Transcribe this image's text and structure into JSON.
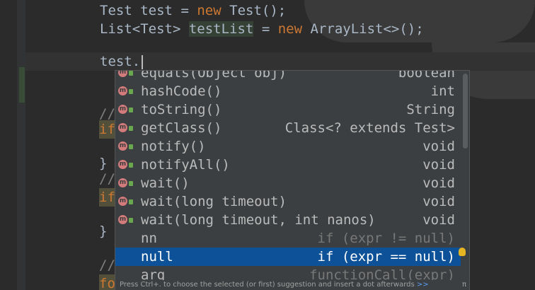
{
  "editor": {
    "line1": {
      "type": "Test",
      "var": "test",
      "op": "=",
      "kw": "new",
      "ctor": "Test();"
    },
    "line2": {
      "type": "List<Test>",
      "var": "testList",
      "op": "=",
      "kw": "new",
      "ctor": "ArrayList<>();"
    },
    "line3": "test.",
    "fragments": {
      "comment1": "//",
      "if1": "if",
      "brace1": "}",
      "comment2": "//",
      "if2": "if",
      "brace2": "}",
      "comment3": "//",
      "for1": "fo"
    }
  },
  "completion": {
    "items": [
      {
        "name": "equals(Object obj)",
        "type": "boolean",
        "kind": "method"
      },
      {
        "name": "hashCode()",
        "type": "int",
        "kind": "method"
      },
      {
        "name": "toString()",
        "type": "String",
        "kind": "method"
      },
      {
        "name": "getClass()",
        "type": "Class<? extends Test>",
        "kind": "method"
      },
      {
        "name": "notify()",
        "type": "void",
        "kind": "method"
      },
      {
        "name": "notifyAll()",
        "type": "void",
        "kind": "method"
      },
      {
        "name": "wait()",
        "type": "void",
        "kind": "method"
      },
      {
        "name": "wait(long timeout)",
        "type": "void",
        "kind": "method"
      },
      {
        "name": "wait(long timeout, int nanos)",
        "type": "void",
        "kind": "method"
      },
      {
        "name": "nn",
        "type": "if (expr != null)",
        "kind": "template"
      },
      {
        "name": "null",
        "type": "if (expr == null)",
        "kind": "template",
        "selected": true
      },
      {
        "name": "arg",
        "type": "functionCall(expr)",
        "kind": "template"
      }
    ],
    "icon_label": "m",
    "hint": "Press Ctrl+. to choose the selected (or first) suggestion and insert a dot afterwards",
    "hint_link": ">>",
    "pi_symbol": "π"
  },
  "colors": {
    "selection": "#0d5298",
    "keyword": "#cc7832",
    "method_icon": "#d47b7b",
    "bulb": "#e6b422"
  },
  "icons": {
    "method": "method-icon",
    "access": "public-lock-icon",
    "bulb": "lightbulb-icon"
  }
}
